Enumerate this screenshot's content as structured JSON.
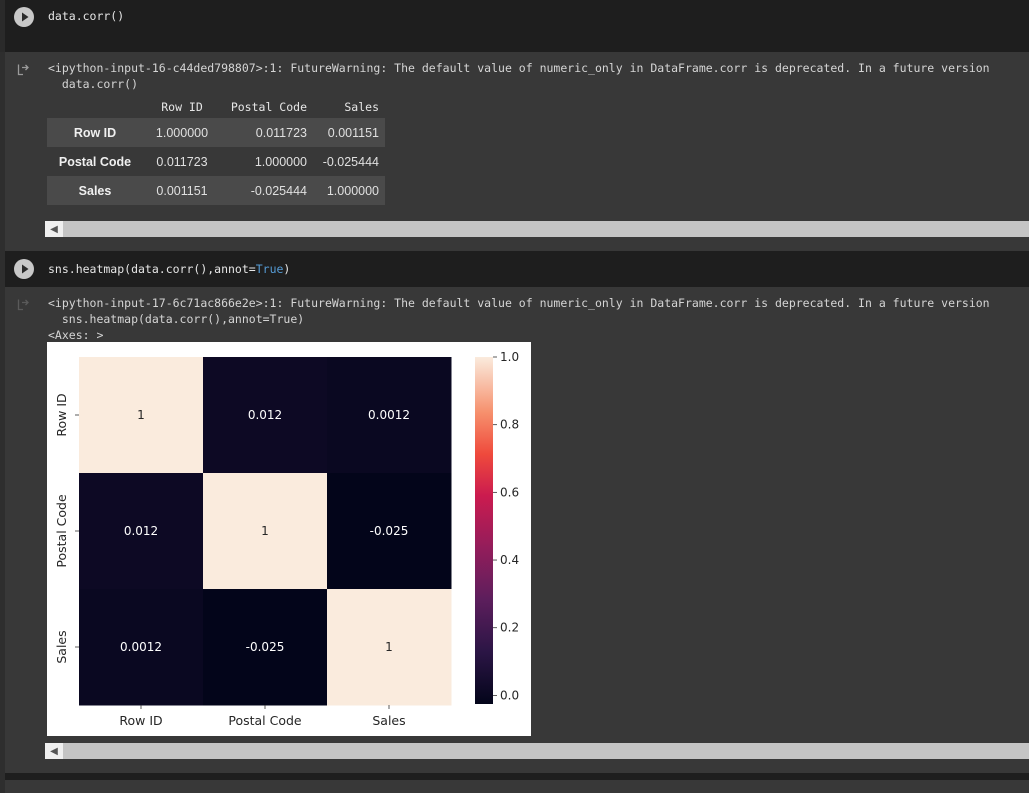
{
  "cell1": {
    "code": "data.corr()",
    "warning_line1": "<ipython-input-16-c44ded798807>:1: FutureWarning: The default value of numeric_only in DataFrame.corr is deprecated. In a future version",
    "warning_line2": "  data.corr()"
  },
  "dataframe": {
    "columns": [
      "Row ID",
      "Postal Code",
      "Sales"
    ],
    "rows": [
      {
        "label": "Row ID",
        "values": [
          "1.000000",
          "0.011723",
          "0.001151"
        ]
      },
      {
        "label": "Postal Code",
        "values": [
          "0.011723",
          "1.000000",
          "-0.025444"
        ]
      },
      {
        "label": "Sales",
        "values": [
          "0.001151",
          "-0.025444",
          "1.000000"
        ]
      }
    ]
  },
  "cell2": {
    "code_prefix": "sns.heatmap(data.corr(),annot=",
    "code_keyword": "True",
    "code_suffix": ")",
    "warning_line1": "<ipython-input-17-6c71ac866e2e>:1: FutureWarning: The default value of numeric_only in DataFrame.corr is deprecated. In a future version",
    "warning_line2": "  sns.heatmap(data.corr(),annot=True)",
    "axes_repr": "<Axes: >"
  },
  "colors": {
    "heat_high": "#faebdd",
    "heat_low": "#03051a",
    "cell_dark_0012": "#0d0820",
    "cell_dark_neg": "#03051a",
    "keyword": "#569cd6"
  },
  "icons": {
    "run": "play-circle-icon",
    "output": "output-arrow-icon",
    "scroll_left": "chevron-left-icon"
  },
  "chart_data": {
    "type": "heatmap",
    "x_labels": [
      "Row ID",
      "Postal Code",
      "Sales"
    ],
    "y_labels": [
      "Row ID",
      "Postal Code",
      "Sales"
    ],
    "values": [
      [
        1.0,
        0.011723,
        0.001151
      ],
      [
        0.011723,
        1.0,
        -0.025444
      ],
      [
        0.001151,
        -0.025444,
        1.0
      ]
    ],
    "annotations": [
      [
        "1",
        "0.012",
        "0.0012"
      ],
      [
        "0.012",
        "1",
        "-0.025"
      ],
      [
        "0.0012",
        "-0.025",
        "1"
      ]
    ],
    "colorbar_ticks": [
      "0.0",
      "0.2",
      "0.4",
      "0.6",
      "0.8",
      "1.0"
    ],
    "colorbar_range": [
      -0.025444,
      1.0
    ],
    "colormap": "rocket"
  }
}
